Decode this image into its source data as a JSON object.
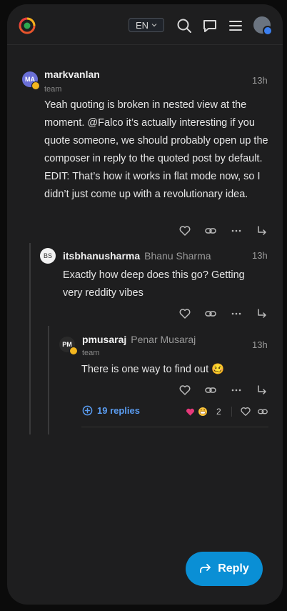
{
  "header": {
    "language": "EN",
    "colors": {
      "accent": "#0a8fd5",
      "link": "#5a9cf0",
      "badge": "#f3b61f"
    }
  },
  "posts": [
    {
      "username": "markvanlan",
      "initials": "MA",
      "user_title": "team",
      "time": "13h",
      "body": "Yeah quoting is broken in nested view at the moment. @Falco it’s actually interesting if you quote someone, we should probably open up the composer in reply to the quoted post by default. EDIT: That’s how it works in flat mode now, so I didn’t just come up with a revolutionary idea."
    },
    {
      "username": "itsbhanusharma",
      "full_name": "Bhanu Sharma",
      "initials": "BS",
      "time": "13h",
      "body": "Exactly how deep does this go? Getting very reddity vibes"
    },
    {
      "username": "pmusaraj",
      "full_name": "Penar Musaraj",
      "initials": "PM",
      "user_title": "team",
      "time": "13h",
      "body": "There is one way to find out 🥴",
      "replies_label": "19 replies",
      "reaction_count": "2"
    }
  ],
  "reply_button": {
    "label": "Reply"
  }
}
